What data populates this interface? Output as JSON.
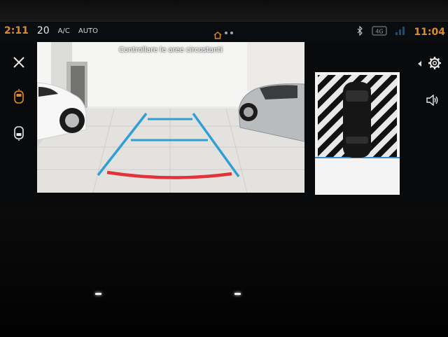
{
  "status_bar": {
    "time_left": "2:11",
    "temperature": "20",
    "ac_label": "A/C",
    "auto_label": "AUTO",
    "signal_label": "4G",
    "clock": "11:04"
  },
  "camera": {
    "title": "Controllare le aree circostanti"
  },
  "icons": {
    "close": "close-icon",
    "front_camera": "car-front-camera-icon",
    "rear_camera": "car-rear-camera-icon",
    "home": "home-icon",
    "bluetooth": "bluetooth-icon",
    "settings": "gear-icon",
    "sound": "speaker-icon"
  },
  "colors": {
    "accent": "#e08a2a",
    "guide_blue": "#2f9fd6",
    "guide_red": "#e0333a"
  }
}
